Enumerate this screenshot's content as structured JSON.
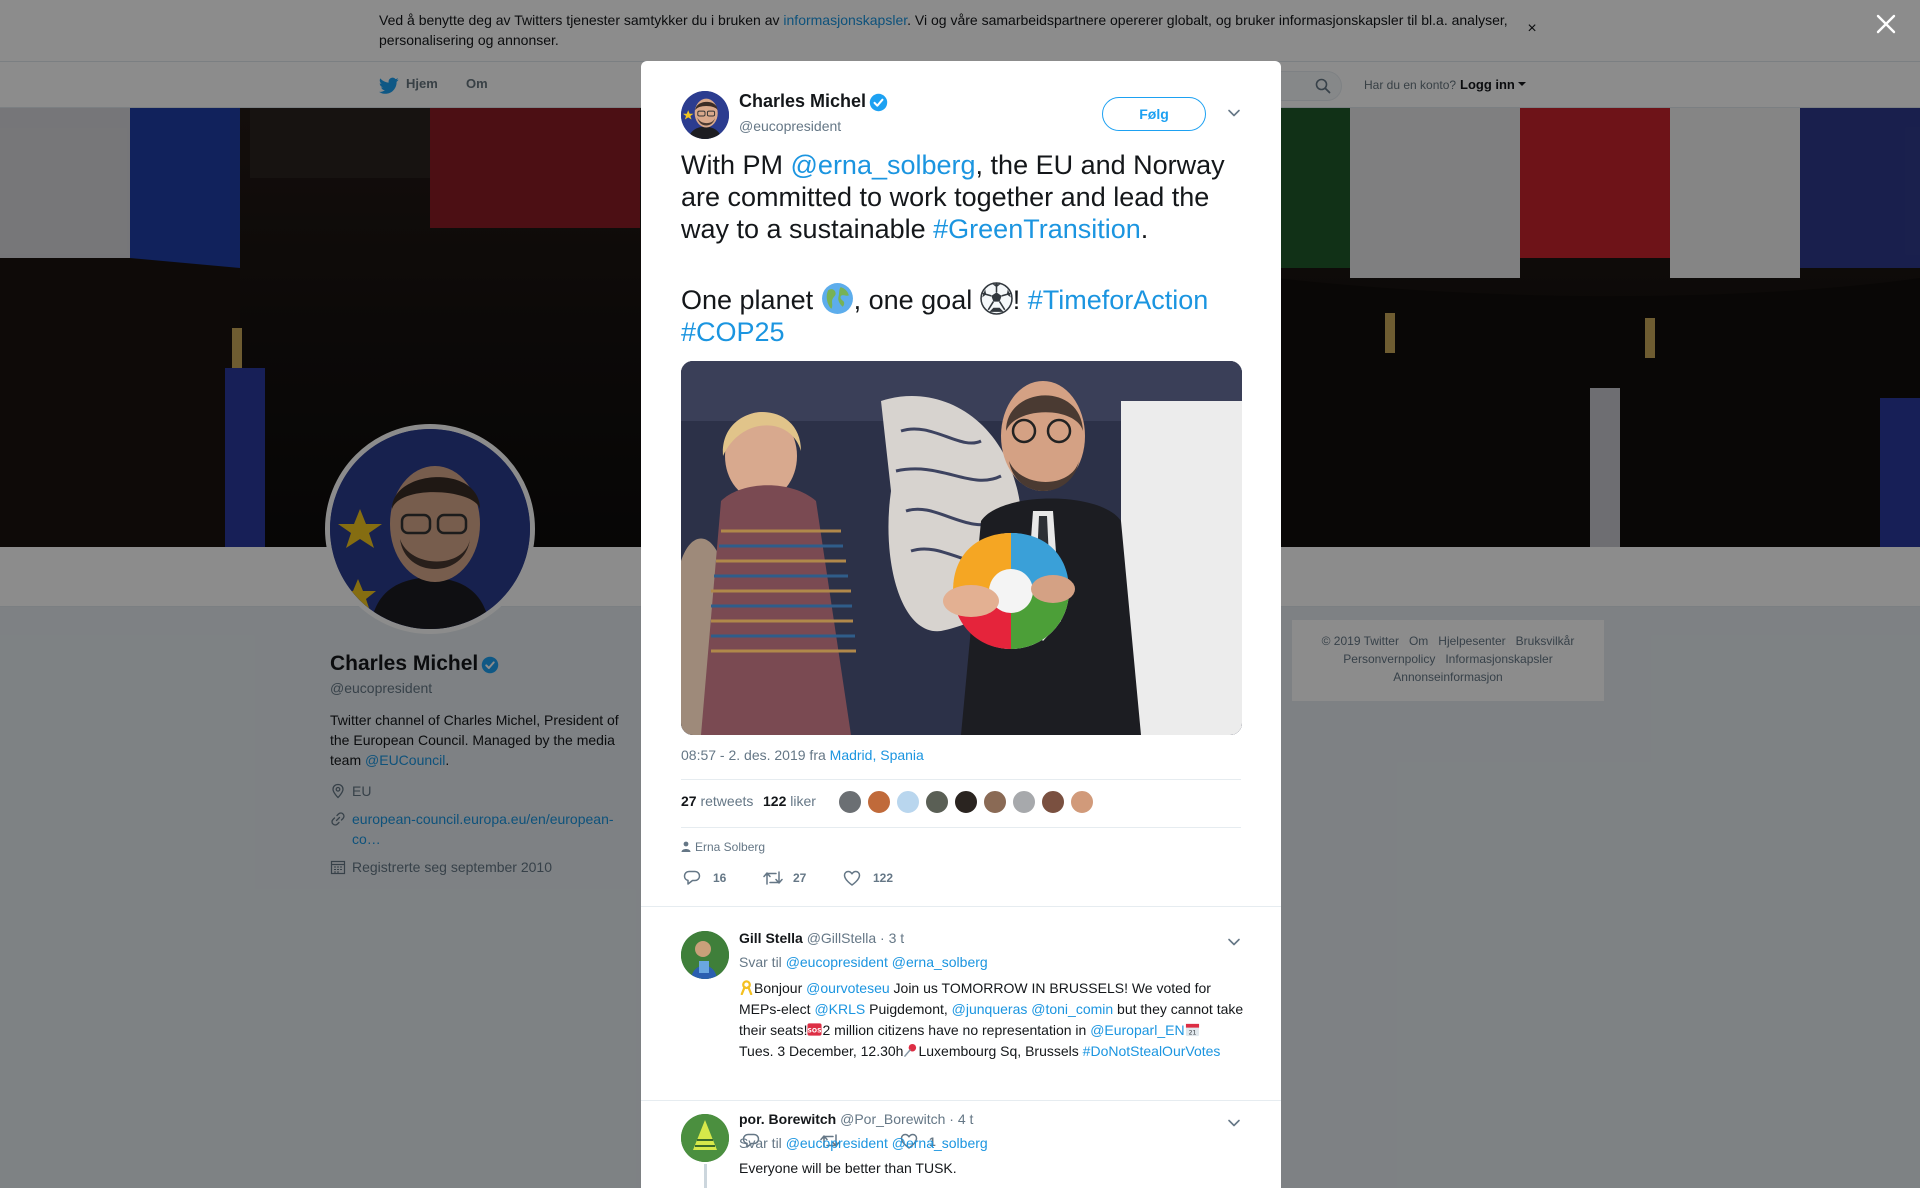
{
  "cookie_bar": {
    "text_before": "Ved å benytte deg av Twitters tjenester samtykker du i bruken av ",
    "link": "informasjonskapsler",
    "text_after": ". Vi og våre samarbeidspartnere opererer globalt, og bruker informasjonskapsler til bl.a. analyser, personalisering og annonser.",
    "close": "×"
  },
  "nav": {
    "home": "Hjem",
    "about": "Om",
    "login_question": "Har du en konto?",
    "login": "Logg inn"
  },
  "profile": {
    "name": "Charles Michel",
    "handle": "@eucopresident",
    "bio_text": "Twitter channel of Charles Michel, President of the European Council. Managed by the media team ",
    "bio_link": "@EUCouncil",
    "bio_end": ".",
    "location": "EU",
    "website": "european-council.europa.eu/en/european-co…",
    "joined": "Registrerte seg september 2010"
  },
  "footer": {
    "line1": [
      "© 2019 Twitter",
      "Om",
      "Hjelpesenter",
      "Bruksvilkår"
    ],
    "line2": [
      "Personvernpolicy",
      "Informasjonskapsler"
    ],
    "line3": [
      "Annonseinformasjon"
    ]
  },
  "tweet": {
    "author_name": "Charles Michel",
    "author_handle": "@eucopresident",
    "follow_label": "Følg",
    "text": {
      "p1_a": "With PM ",
      "p1_mention": "@erna_solberg",
      "p1_b": ", the EU and Norway are committed to work together and lead the way to a sustainable ",
      "p1_hashtag": "#GreenTransition",
      "p1_c": ".",
      "p2_a": "One planet ",
      "p2_b": ", one goal ",
      "p2_c": "! ",
      "p2_hashtag1": "#TimeforAction",
      "p2_hashtag2": "#COP25"
    },
    "timestamp": "08:57 - 2. des. 2019 fra ",
    "place": "Madrid, Spania",
    "retweets_count": "27",
    "retweets_label": "retweets",
    "likes_count": "122",
    "likes_label": "liker",
    "tagged": "Erna Solberg",
    "actions": {
      "replies": "16",
      "retweets": "27",
      "likes": "122"
    }
  },
  "replies": [
    {
      "name": "Gill Stella",
      "handle": "@GillStella",
      "time": "· 3 t",
      "reply_to_label": "Svar til ",
      "reply_to": [
        "@eucopresident",
        "@erna_solberg"
      ],
      "body": {
        "t1": "Bonjour ",
        "m1": "@ourvoteseu",
        "t2": " Join us TOMORROW IN BRUSSELS! We voted for MEPs-elect ",
        "m2": "@KRLS",
        "t3": " Puigdemont, ",
        "m3": "@junqueras",
        "t4": " ",
        "m4": "@toni_comin",
        "t5": " but they cannot take their seats!",
        "t6": "2 million citizens have no representation in ",
        "m5": "@Europarl_EN",
        "t7": " Tues. 3 December, 12.30h",
        "t8": "Luxembourg Sq, Brussels ",
        "h1": "#DoNotStealOurVotes"
      },
      "likes": "1"
    },
    {
      "name": "por. Borewitch",
      "handle": "@Por_Borewitch",
      "time": "· 4 t",
      "reply_to_label": "Svar til ",
      "reply_to": [
        "@eucopresident",
        "@erna_solberg"
      ],
      "body_text": "Everyone will be better than TUSK."
    }
  ],
  "colors": {
    "accent": "#1da1f2",
    "link": "#1b95e0",
    "muted": "#657786"
  }
}
